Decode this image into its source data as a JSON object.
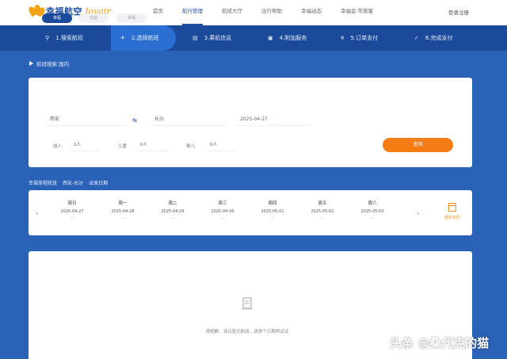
{
  "brand": {
    "name": "幸福航空",
    "name_en": "Joyair"
  },
  "nav": {
    "links": [
      "首页",
      "航行管理",
      "航班大厅",
      "出行帮助",
      "幸福动态",
      "幸福会·常旅客"
    ],
    "active_index": 1,
    "user": "登录注册"
  },
  "steps": [
    {
      "label": "1.搜索航班",
      "icon": "search-icon"
    },
    {
      "label": "2.选择航班",
      "icon": "plane-icon",
      "active": true
    },
    {
      "label": "3.乘机信息",
      "icon": "document-icon"
    },
    {
      "label": "4.附加服务",
      "icon": "cart-icon"
    },
    {
      "label": "5.订单支付",
      "icon": "yen-icon"
    },
    {
      "label": "6.完成支付",
      "icon": "check-icon"
    }
  ],
  "breadcrumb": "航班搜索 国内",
  "search": {
    "trip_types": [
      "单程",
      "往返",
      "多程"
    ],
    "active_trip_index": 0,
    "from": "西安",
    "to": "长沙",
    "date": "2025-04-27",
    "passengers": [
      {
        "label": "成人",
        "value": "1人"
      },
      {
        "label": "儿童",
        "value": "0人"
      },
      {
        "label": "婴儿",
        "value": "0人"
      }
    ],
    "button": "查询"
  },
  "info": {
    "title": "幸福单程航班",
    "route": "西安-长沙",
    "date_label": "出发日期"
  },
  "dates": [
    {
      "weekday": "周日",
      "date": "2025-04-27",
      "price": "--"
    },
    {
      "weekday": "周一",
      "date": "2025-04-28",
      "price": "--"
    },
    {
      "weekday": "周二",
      "date": "2025-04-29",
      "price": "--"
    },
    {
      "weekday": "周三",
      "date": "2025-04-30",
      "price": "--"
    },
    {
      "weekday": "周四",
      "date": "2025-05-01",
      "price": "--"
    },
    {
      "weekday": "周五",
      "date": "2025-05-02",
      "price": "--"
    },
    {
      "weekday": "周六",
      "date": "2025-05-03",
      "price": "--"
    }
  ],
  "calendar_label": "低价日历",
  "empty_message": "很抱歉，该日暂无航班，请换个日期再试试",
  "watermark": "头条 @桑代克的猫",
  "colors": {
    "primary": "#1b4a9a",
    "accent": "#f47c14",
    "brand_gold": "#f2a514"
  }
}
